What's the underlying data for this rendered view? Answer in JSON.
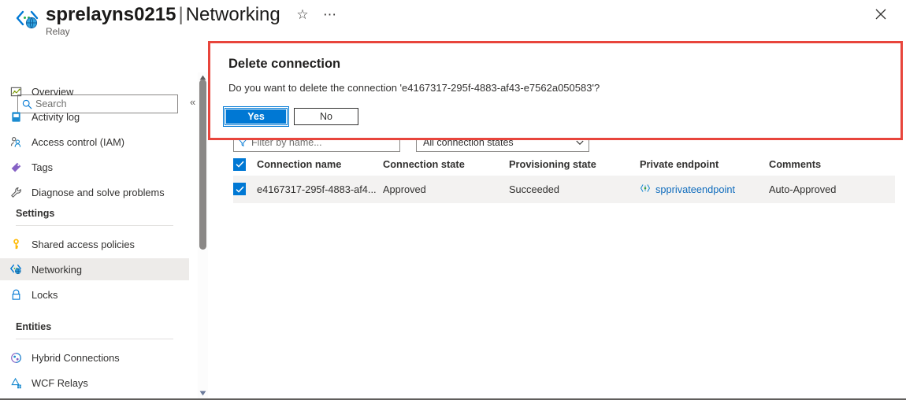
{
  "header": {
    "icon": "relay-icon",
    "resource_name": "sprelayns0215",
    "separator": "|",
    "page_name": "Networking",
    "subtitle": "Relay",
    "favorite_icon": "star-icon",
    "more_icon": "ellipsis-icon",
    "close_icon": "close-icon"
  },
  "sidebar": {
    "search": {
      "placeholder": "Search",
      "value": "",
      "icon": "search-icon"
    },
    "collapse_icon": "chevron-double-left-icon",
    "items": [
      {
        "label": "Overview",
        "icon": "overview-icon",
        "selected": false
      },
      {
        "label": "Activity log",
        "icon": "activity-log-icon",
        "selected": false
      },
      {
        "label": "Access control (IAM)",
        "icon": "people-icon",
        "selected": false
      },
      {
        "label": "Tags",
        "icon": "tag-icon",
        "selected": false
      },
      {
        "label": "Diagnose and solve problems",
        "icon": "wrench-icon",
        "selected": false
      }
    ],
    "groups": [
      {
        "label": "Settings",
        "items": [
          {
            "label": "Shared access policies",
            "icon": "key-icon",
            "selected": false
          },
          {
            "label": "Networking",
            "icon": "networking-icon",
            "selected": true
          },
          {
            "label": "Locks",
            "icon": "lock-icon",
            "selected": false
          }
        ]
      },
      {
        "label": "Entities",
        "items": [
          {
            "label": "Hybrid Connections",
            "icon": "hybrid-connections-icon",
            "selected": false
          },
          {
            "label": "WCF Relays",
            "icon": "wcf-relays-icon",
            "selected": false
          }
        ]
      }
    ],
    "scrollbar": {
      "up_icon": "scroll-up-arrow-icon",
      "down_icon": "scroll-down-arrow-icon"
    }
  },
  "dialog": {
    "title": "Delete connection",
    "message": "Do you want to delete the connection 'e4167317-295f-4883-af43-e7562a050583'?",
    "yes_label": "Yes",
    "no_label": "No",
    "highlight_color": "#e8453c",
    "primary_color": "#0078d4"
  },
  "filters": {
    "name_filter": {
      "placeholder": "Filter by name...",
      "value": "",
      "icon": "filter-icon"
    },
    "state_filter": {
      "value": "All connection states",
      "chevron_icon": "chevron-down-icon"
    }
  },
  "table": {
    "select_all_checked": true,
    "columns": [
      "Connection name",
      "Connection state",
      "Provisioning state",
      "Private endpoint",
      "Comments"
    ],
    "rows": [
      {
        "checked": true,
        "connection_name": "e4167317-295f-4883-af4...",
        "connection_state": "Approved",
        "provisioning_state": "Succeeded",
        "private_endpoint": "spprivateendpoint",
        "private_endpoint_icon": "private-endpoint-icon",
        "comments": "Auto-Approved"
      }
    ]
  }
}
